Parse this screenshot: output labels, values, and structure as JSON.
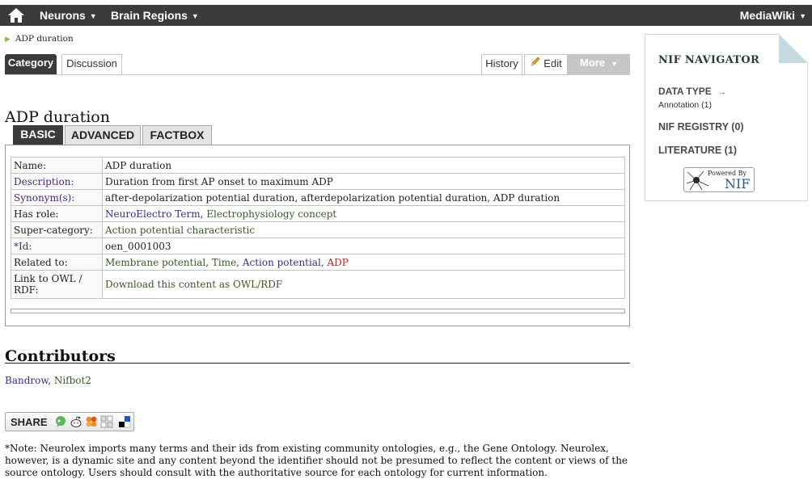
{
  "topbar": {
    "menu_neurons": "Neurons",
    "menu_brain_regions": "Brain Regions",
    "menu_mediawiki": "MediaWiki",
    "home_icon": "home-icon",
    "caret_glyph": "▼"
  },
  "breadcrumb": {
    "label": "ADP duration"
  },
  "tabs": {
    "category": "Category",
    "discussion": "Discussion",
    "history": "History",
    "edit": "Edit",
    "more": "More"
  },
  "page": {
    "title": "ADP duration"
  },
  "subtabs": {
    "basic": "BASIC",
    "advanced": "ADVANCED",
    "factbox": "FACTBOX"
  },
  "info": {
    "name_label": "Name:",
    "name_value": "ADP duration",
    "description_label": "Description:",
    "description_value": "Duration from first AP onset to maximum ADP",
    "synonyms_label": "Synonym(s):",
    "synonyms_value": "after-depolarization potential duration, afterdepolarization potential duration, ADP duration",
    "has_role_label": "Has role:",
    "has_role_1": "NeuroElectro Term",
    "has_role_sep": ", ",
    "has_role_2": "Electrophysiology concept",
    "super_category_label": "Super-category:",
    "super_category_value": "Action potential characteristic",
    "id_label": "*Id:",
    "id_value": "oen_0001003",
    "related_label": "Related to:",
    "related_1": "Membrane potential",
    "related_2": "Time",
    "related_3": "Action potential",
    "related_4": "ADP",
    "related_sep": ", ",
    "owl_label": "Link to OWL / RDF:",
    "owl_value": "Download this content as OWL/RDF"
  },
  "contributors": {
    "heading": "Contributors",
    "user_1": "Bandrow",
    "sep": ", ",
    "user_2": "Nifbot2"
  },
  "share": {
    "label": "SHARE"
  },
  "note": {
    "text": "*Note: Neurolex imports many terms and their ids from existing community ontologies, e.g., the Gene Ontology. Neurolex, however, is a dynamic site and any content beyond the identifier should not be presumed to reflect the content or views of the source ontology. Users should consult with the authoritative source for each ontology for current information."
  },
  "nif": {
    "title": "NIF NAVIGATOR",
    "data_type": "DATA TYPE",
    "data_type_arrow": "→",
    "annotation": "Annotation (1)",
    "registry": "NIF REGISTRY (0)",
    "literature": "LITERATURE (1)",
    "powered_by": "Powered By",
    "powered_nif": "NIF"
  }
}
